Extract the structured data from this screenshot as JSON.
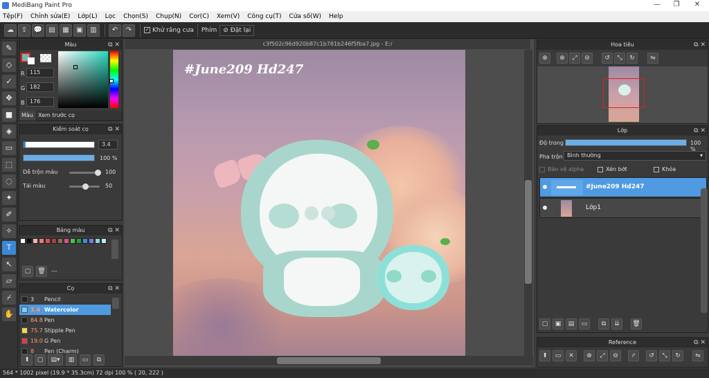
{
  "window": {
    "title": "MediBang Paint Pro",
    "controls": {
      "minimize": "—",
      "maximize": "❐",
      "close": "✕"
    }
  },
  "menu": [
    "Tệp(F)",
    "Chỉnh sửa(E)",
    "Lớp(L)",
    "Lọc",
    "Chọn(S)",
    "Chụp(N)",
    "Cor(C)",
    "Xem(V)",
    "Công cụ(T)",
    "Cửa số(W)",
    "Help"
  ],
  "toolbar": {
    "antialias_label": "Khử răng cưa",
    "keys_label": "Phím",
    "reset_label": "Đặt lại"
  },
  "color_panel": {
    "title": "Màu",
    "r_label": "R",
    "r_value": "115",
    "g_label": "G",
    "g_value": "182",
    "b_label": "B",
    "b_value": "176",
    "tab_color": "Màu",
    "tab_preview": "Xem trước cọ",
    "current_color": "#73b6b0"
  },
  "brush_control": {
    "title": "Kiểm soát cọ",
    "size_value": "3.4",
    "opacity_value": "100 %",
    "mix_label": "Dễ trộn màu",
    "mix_value": "100",
    "reload_label": "Tải màu",
    "reload_value": "50"
  },
  "palette": {
    "title": "Bảng màu",
    "name": "---",
    "swatches": [
      "#ffffff",
      "#111111",
      "#f2b3b3",
      "#e07d7d",
      "#d95050",
      "#b33b3b",
      "#8a6b5c",
      "#e0508c",
      "#49c449",
      "#2e9e2e",
      "#3a8fd9",
      "#7b7bd9",
      "#8fd3e0",
      "#bfe8f2"
    ]
  },
  "brush_list": {
    "title": "Cọ",
    "items": [
      {
        "size": "3",
        "name": "Pencil",
        "color": "#222222",
        "selected": false
      },
      {
        "size": "3.4",
        "name": "Watercolor",
        "color": "#73d0f0",
        "selected": true
      },
      {
        "size": "84.8",
        "name": "Pen",
        "color": "#222222",
        "selected": false
      },
      {
        "size": "75.7",
        "name": "Stipple Pen",
        "color": "#f2d64a",
        "selected": false
      },
      {
        "size": "19.0",
        "name": "G Pen",
        "color": "#e04040",
        "selected": false
      },
      {
        "size": "8",
        "name": "Pen (Charm)",
        "color": "#222222",
        "selected": false
      }
    ]
  },
  "canvas": {
    "tab_title": "c3f502c96d920b87c1b781b246f5fba7.jpg - E:/",
    "art_text": "#June209 Hd247"
  },
  "navigator": {
    "title": "Hoa tiêu"
  },
  "layer_panel": {
    "title": "Lớp",
    "opacity_label": "Độ trong",
    "opacity_value": "100 %",
    "blend_label": "Pha trộn",
    "blend_value": "Bình thường",
    "protect_alpha": "Bảo vệ alpha",
    "clipping": "Xén bớt",
    "lock": "Khóa",
    "layers": [
      {
        "name": "#June209 Hd247",
        "selected": true
      },
      {
        "name": "Lớp1",
        "selected": false
      }
    ]
  },
  "reference_panel": {
    "title": "Reference"
  },
  "status": {
    "text": "564 * 1002 pixel   (19.9 * 35.3cm)   72 dpi   100 %   ( 20, 222 )"
  },
  "colors": {
    "accent": "#3b88d8",
    "selection_red": "#e02020",
    "mint": "#a9e0d6"
  }
}
